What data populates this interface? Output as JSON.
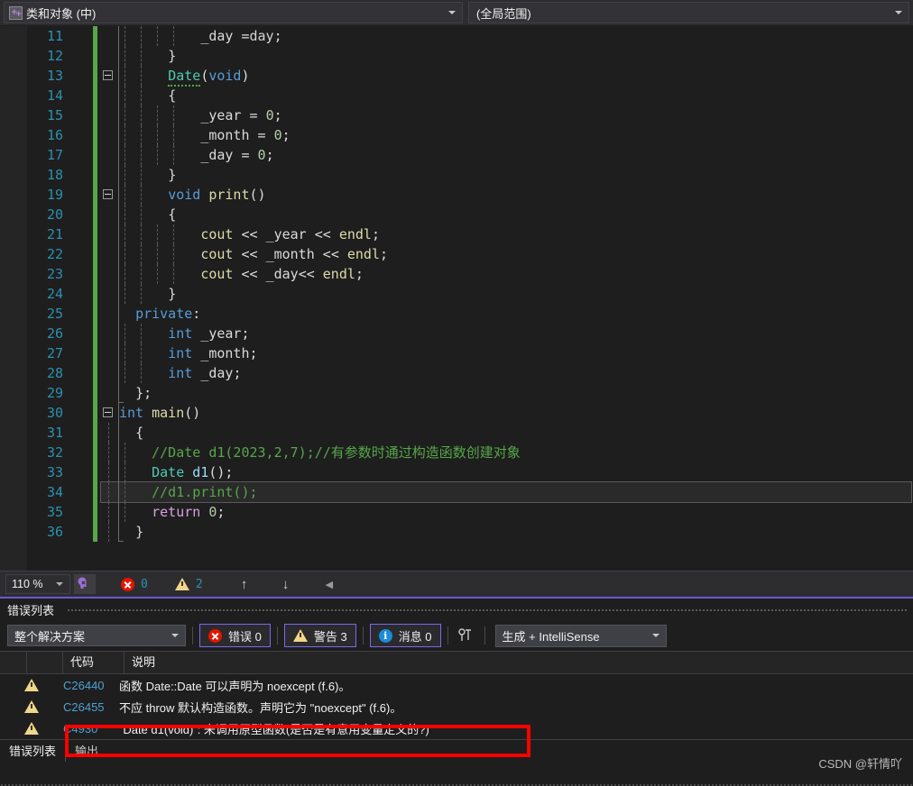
{
  "navbar": {
    "file_icon": "cpp-file-icon",
    "member_scope": "类和对象 (中)",
    "global_scope": "(全局范围)"
  },
  "editor": {
    "first_line": 11,
    "current_line": 34,
    "lines": [
      {
        "n": 11,
        "indent": 5,
        "html": "_day =day;"
      },
      {
        "n": 12,
        "indent": 3,
        "html": "}"
      },
      {
        "n": 13,
        "indent": 3,
        "html": "Date(void)"
      },
      {
        "n": 14,
        "indent": 3,
        "html": "{"
      },
      {
        "n": 15,
        "indent": 5,
        "html": "_year = 0;"
      },
      {
        "n": 16,
        "indent": 5,
        "html": "_month = 0;"
      },
      {
        "n": 17,
        "indent": 5,
        "html": "_day = 0;"
      },
      {
        "n": 18,
        "indent": 3,
        "html": "}"
      },
      {
        "n": 19,
        "indent": 3,
        "html": "void print()"
      },
      {
        "n": 20,
        "indent": 3,
        "html": "{"
      },
      {
        "n": 21,
        "indent": 5,
        "html": "cout << _year << endl;"
      },
      {
        "n": 22,
        "indent": 5,
        "html": "cout << _month << endl;"
      },
      {
        "n": 23,
        "indent": 5,
        "html": "cout << _day<< endl;"
      },
      {
        "n": 24,
        "indent": 3,
        "html": "}"
      },
      {
        "n": 25,
        "indent": 1,
        "html": "private:"
      },
      {
        "n": 26,
        "indent": 3,
        "html": "int _year;"
      },
      {
        "n": 27,
        "indent": 3,
        "html": "int _month;"
      },
      {
        "n": 28,
        "indent": 3,
        "html": "int _day;"
      },
      {
        "n": 29,
        "indent": 1,
        "html": "};"
      },
      {
        "n": 30,
        "indent": 0,
        "html": "int main()"
      },
      {
        "n": 31,
        "indent": 1,
        "html": "{"
      },
      {
        "n": 32,
        "indent": 2,
        "html": "//Date d1(2023,2,7);//有参数时通过构造函数创建对象"
      },
      {
        "n": 33,
        "indent": 2,
        "html": "Date d1();"
      },
      {
        "n": 34,
        "indent": 2,
        "html": "//d1.print();"
      },
      {
        "n": 35,
        "indent": 2,
        "html": "return 0;"
      },
      {
        "n": 36,
        "indent": 1,
        "html": "}"
      }
    ]
  },
  "editor_status": {
    "zoom_level": "110 %",
    "pen_icon": "intellisense-pen-icon",
    "error_icon": "error-circle-icon",
    "error_count": "0",
    "warning_icon": "warning-triangle-icon",
    "warning_count": "2",
    "prev_icon": "arrow-up-icon",
    "next_icon": "arrow-down-icon",
    "collapse_icon": "triangle-left-icon"
  },
  "panel": {
    "title": "错误列表",
    "toolbar": {
      "scope_filter": "整个解决方案",
      "errors_label": "错误 0",
      "warnings_label": "警告 3",
      "messages_label": "消息 0",
      "wrench_icon": "build-filter-icon",
      "build_filter": "生成 + IntelliSense"
    },
    "table": {
      "columns": [
        "",
        "",
        "代码",
        "说明"
      ],
      "rows": [
        {
          "severity": "warning",
          "code": "C26440",
          "description": "函数 Date::Date 可以声明为 noexcept (f.6)。",
          "highlighted": false
        },
        {
          "severity": "warning",
          "code": "C26455",
          "description": "不应 throw 默认构造函数。声明它为 \"noexcept\" (f.6)。",
          "highlighted": false
        },
        {
          "severity": "warning",
          "code": "C4930",
          "description": "“Date d1(void)”: 未调用原型函数(是否是有意用变量定义的?)",
          "highlighted": true
        }
      ]
    },
    "tabs": [
      {
        "label": "错误列表",
        "active": true
      },
      {
        "label": "输出",
        "active": false
      }
    ]
  },
  "watermark": "CSDN @轩情吖",
  "colors": {
    "accent": "#7b68ee",
    "error": "#e51400",
    "warning": "#f0d68a",
    "info": "#1b8cd8",
    "changebar": "#57a64a",
    "highlight_box": "#ff0000",
    "editor_bg": "#1e1e1e",
    "linenum": "#2b91af"
  }
}
